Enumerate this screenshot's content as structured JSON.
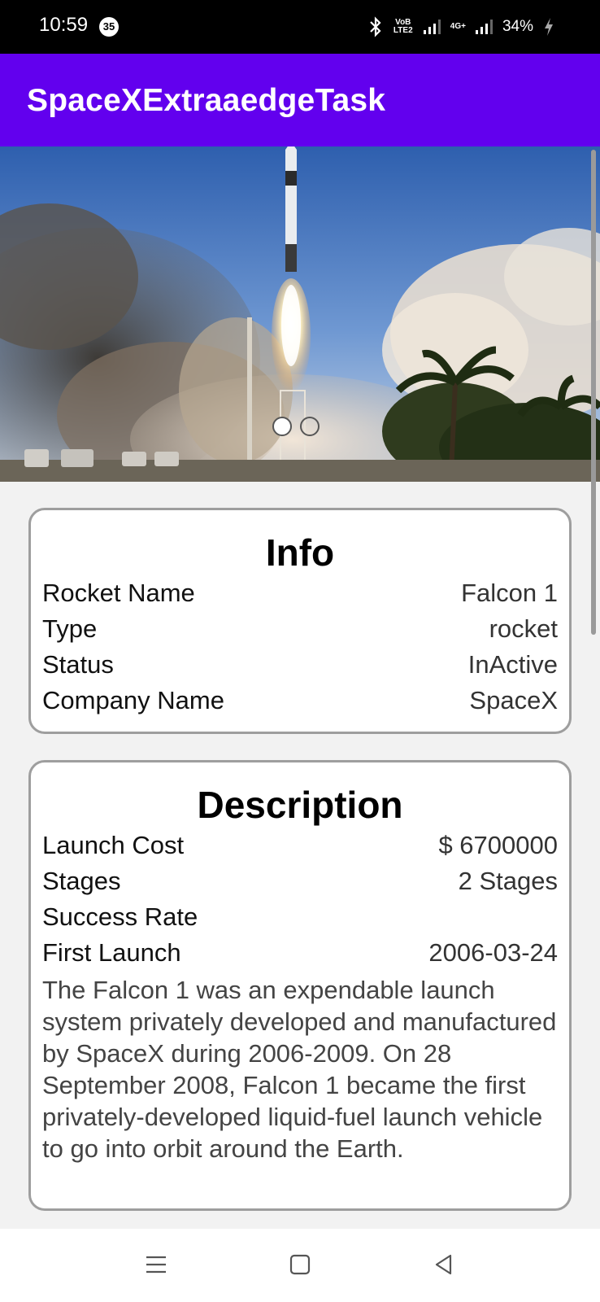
{
  "status_bar": {
    "time": "10:59",
    "notification_count": "35",
    "network_label_1": "VoB LTE2",
    "network_label_2": "4G+",
    "battery": "34%"
  },
  "app_bar": {
    "title": "SpaceXExtraaedgeTask"
  },
  "carousel": {
    "total_pages": 2,
    "active_page": 1
  },
  "info": {
    "heading": "Info",
    "rows": [
      {
        "label": "Rocket Name",
        "value": "Falcon 1"
      },
      {
        "label": "Type",
        "value": "rocket"
      },
      {
        "label": "Status",
        "value": "InActive"
      },
      {
        "label": "Company Name",
        "value": "SpaceX"
      }
    ]
  },
  "description": {
    "heading": "Description",
    "rows": [
      {
        "label": "Launch Cost",
        "value": "$ 6700000"
      },
      {
        "label": "Stages",
        "value": "2 Stages"
      },
      {
        "label": "Success Rate",
        "value": ""
      },
      {
        "label": "First Launch",
        "value": "2006-03-24"
      }
    ],
    "text": "The Falcon 1 was an expendable launch system privately developed and manufactured by SpaceX during 2006-2009. On 28 September 2008, Falcon 1 became the first privately-developed liquid-fuel launch vehicle to go into orbit around the Earth."
  },
  "colors": {
    "primary": "#6200ee",
    "status_bar": "#000000",
    "background": "#f2f2f2"
  },
  "nav_bar": {
    "icons": [
      "menu-icon",
      "home-icon",
      "back-icon"
    ]
  }
}
